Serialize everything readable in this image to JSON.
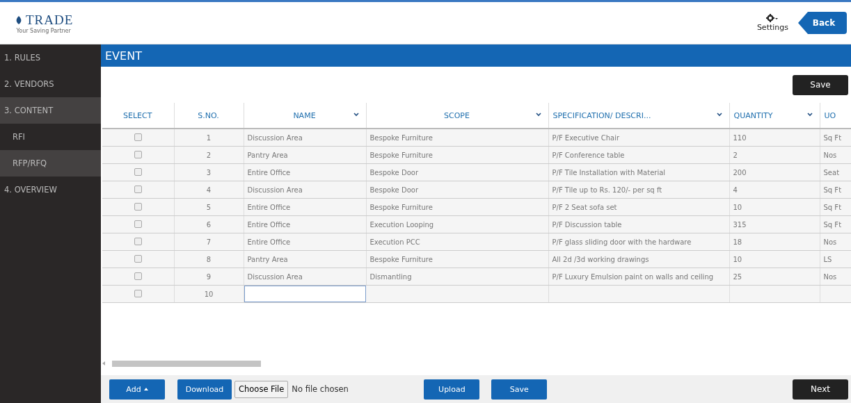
{
  "logo": {
    "name": "TRADE",
    "tagline": "Your Saving Partner"
  },
  "header": {
    "settings_label": "Settings",
    "back_label": "Back"
  },
  "sidebar": {
    "items": [
      {
        "label": "1. RULES",
        "selected": false
      },
      {
        "label": "2. VENDORS",
        "selected": false
      },
      {
        "label": "3. CONTENT",
        "selected": true,
        "children": [
          {
            "label": "RFI",
            "selected": false
          },
          {
            "label": "RFP/RFQ",
            "selected": true
          }
        ]
      },
      {
        "label": "4. OVERVIEW",
        "selected": false
      }
    ]
  },
  "section_title": "EVENT",
  "top_save": "Save",
  "table": {
    "columns": [
      {
        "label": "SELECT",
        "kind": "check",
        "dropdown": false
      },
      {
        "label": "S.NO.",
        "kind": "center",
        "dropdown": false
      },
      {
        "label": "NAME",
        "kind": "text",
        "dropdown": true
      },
      {
        "label": "SCOPE",
        "kind": "text",
        "dropdown": true
      },
      {
        "label": "SPECIFICATION/ DESCRI...",
        "kind": "text",
        "dropdown": true
      },
      {
        "label": "QUANTITY",
        "kind": "text",
        "dropdown": true
      },
      {
        "label": "UO",
        "kind": "text",
        "dropdown": false
      }
    ],
    "rows": [
      {
        "checked": false,
        "cells": [
          "",
          "1",
          "Discussion Area",
          "Bespoke Furniture",
          "P/F Executive Chair",
          "110",
          "Sq Ft"
        ]
      },
      {
        "checked": false,
        "cells": [
          "",
          "2",
          "Pantry Area",
          "Bespoke Furniture",
          "P/F Conference table",
          "2",
          "Nos"
        ]
      },
      {
        "checked": false,
        "cells": [
          "",
          "3",
          "Entire Office",
          "Bespoke Door",
          "P/F Tile Installation with Material",
          "200",
          "Seat"
        ]
      },
      {
        "checked": false,
        "cells": [
          "",
          "4",
          "Discussion Area",
          "Bespoke Door",
          "P/F Tile up to Rs. 120/- per sq ft",
          "4",
          "Sq Ft"
        ]
      },
      {
        "checked": false,
        "cells": [
          "",
          "5",
          "Entire Office",
          "Bespoke Furniture",
          "P/F 2 Seat sofa set",
          "10",
          "Sq Ft"
        ]
      },
      {
        "checked": false,
        "cells": [
          "",
          "6",
          "Entire Office",
          "Execution Looping",
          "P/F Discussion table",
          "315",
          "Sq Ft"
        ]
      },
      {
        "checked": false,
        "cells": [
          "",
          "7",
          "Entire Office",
          "Execution PCC",
          "P/F glass sliding door with the hardware",
          "18",
          "Nos"
        ]
      },
      {
        "checked": false,
        "cells": [
          "",
          "8",
          "Pantry Area",
          "Bespoke Furniture",
          "All 2d /3d working drawings",
          "10",
          "LS"
        ]
      },
      {
        "checked": false,
        "cells": [
          "",
          "9",
          "Discussion Area",
          "Dismantling",
          "P/F Luxury Emulsion paint on walls and ceiling",
          "25",
          "Nos"
        ]
      },
      {
        "checked": false,
        "editing": true,
        "cells": [
          "",
          "10",
          "",
          "",
          "",
          "",
          ""
        ]
      }
    ]
  },
  "footer": {
    "add": "Add",
    "download": "Download",
    "choose_file": "Choose File",
    "file_status": "No file chosen",
    "upload": "Upload",
    "save": "Save",
    "next": "Next"
  }
}
